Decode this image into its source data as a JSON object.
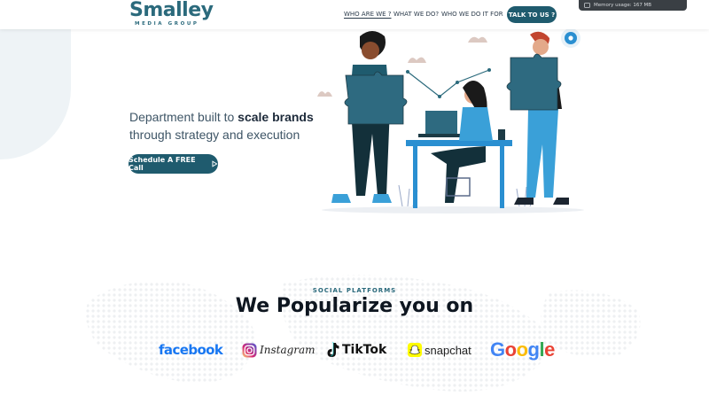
{
  "header": {
    "logo_text": "Smalley",
    "logo_subtext": "MEDIA GROUP",
    "nav": [
      {
        "label": "WHO ARE WE ?",
        "active": true
      },
      {
        "label": "WHAT WE DO?",
        "active": false
      },
      {
        "label": "WHO WE DO IT FOR",
        "active": false
      }
    ],
    "cta_label": "TALK TO US ?"
  },
  "memory_badge": "Memory usage: 167 MB",
  "hero": {
    "line1_prefix": "Department built to ",
    "line1_bold": "scale brands",
    "line2": "through strategy and execution",
    "cta_label": "Schedule A FREE Call"
  },
  "social": {
    "eyebrow": "SOCIAL PLATFORMS",
    "title": "We Popularize you on",
    "platforms": {
      "facebook": "facebook",
      "instagram": "Instagram",
      "tiktok": "TikTok",
      "snapchat": "snapchat",
      "google": "Google"
    }
  },
  "colors": {
    "brand": "#1f5b6e",
    "facebook": "#1877f2",
    "google_blue": "#4285f4",
    "google_red": "#ea4335",
    "google_yellow": "#fbbc05",
    "google_green": "#34a853"
  }
}
